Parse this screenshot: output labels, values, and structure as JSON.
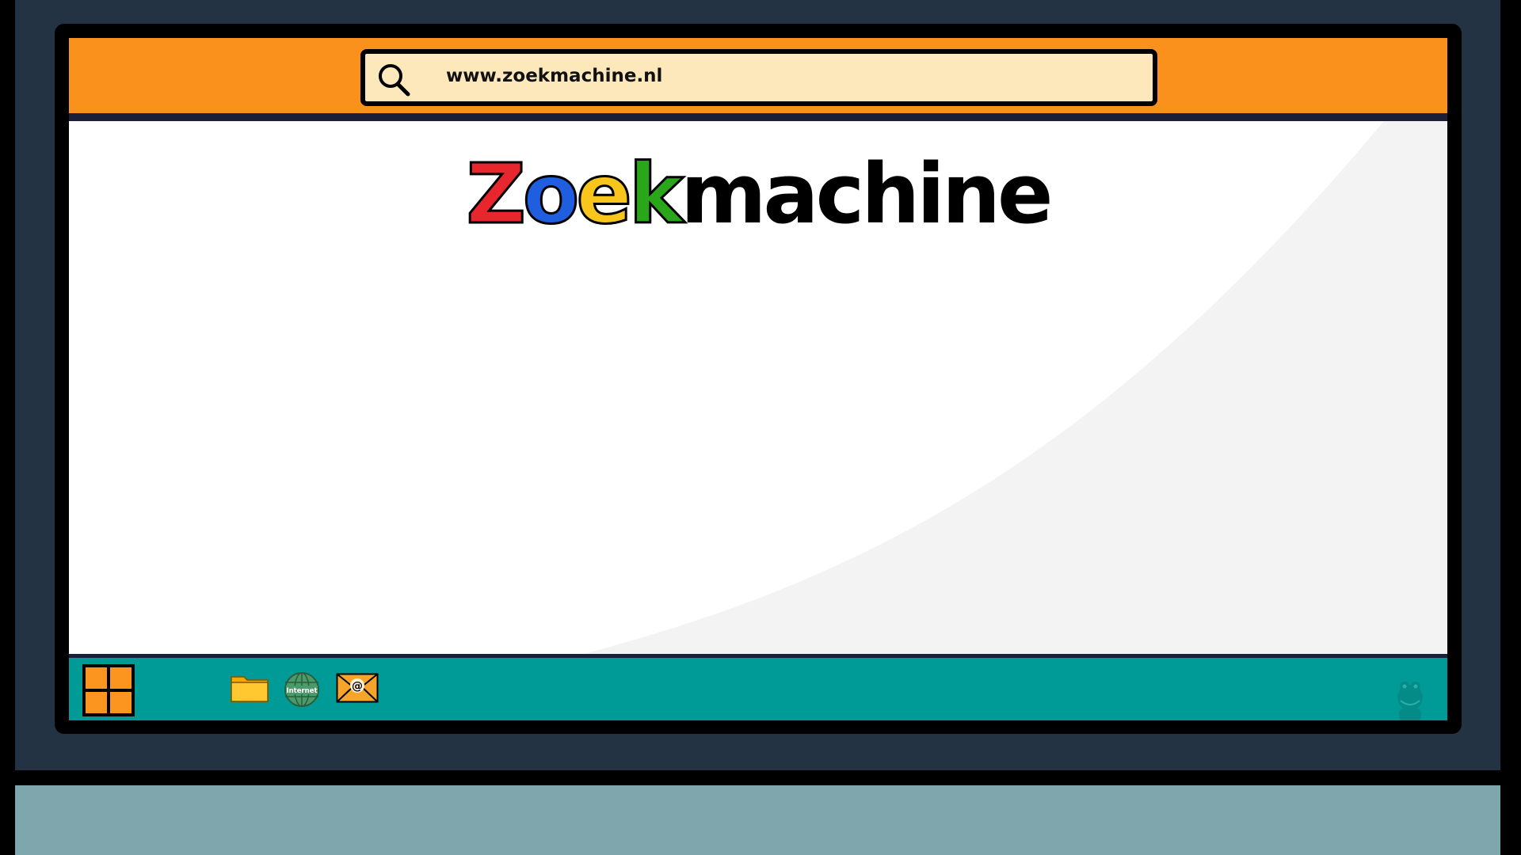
{
  "browser": {
    "url": "www.zoekmachine.nl",
    "search_icon": "search-icon"
  },
  "logo": {
    "letters": [
      "Z",
      "o",
      "e",
      "k"
    ],
    "rest": "machine",
    "colors": [
      "#e8262e",
      "#1f5ede",
      "#f7c51c",
      "#2aa61b",
      "#000000"
    ]
  },
  "taskbar": {
    "start_icon": "windows-start-icon",
    "apps": [
      {
        "icon": "folder-icon"
      },
      {
        "icon": "internet-globe-icon",
        "label": "Internet"
      },
      {
        "icon": "mail-envelope-icon",
        "label": "@"
      }
    ],
    "tray_icon": "mascot-icon"
  },
  "colors": {
    "address_bar": "#fa911c",
    "url_field": "#fde8bb",
    "taskbar": "#009b96",
    "monitor": "#243343",
    "desk": "#80a6ad"
  }
}
